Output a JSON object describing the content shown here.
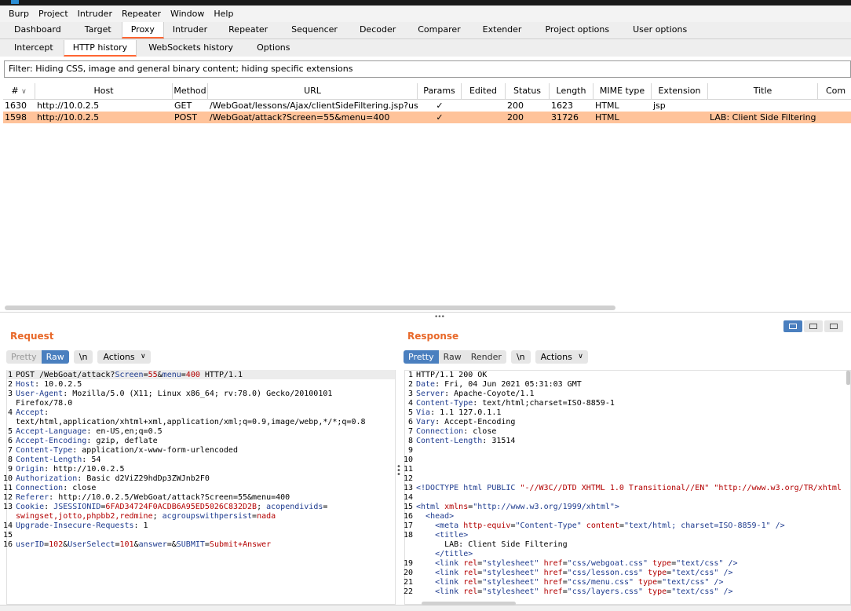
{
  "menubar": [
    "Burp",
    "Project",
    "Intruder",
    "Repeater",
    "Window",
    "Help"
  ],
  "main_tabs": [
    {
      "label": "Dashboard",
      "active": false
    },
    {
      "label": "Target",
      "active": false
    },
    {
      "label": "Proxy",
      "active": true
    },
    {
      "label": "Intruder",
      "active": false
    },
    {
      "label": "Repeater",
      "active": false
    },
    {
      "label": "Sequencer",
      "active": false
    },
    {
      "label": "Decoder",
      "active": false
    },
    {
      "label": "Comparer",
      "active": false
    },
    {
      "label": "Extender",
      "active": false
    },
    {
      "label": "Project options",
      "active": false
    },
    {
      "label": "User options",
      "active": false
    }
  ],
  "sub_tabs": [
    {
      "label": "Intercept",
      "active": false
    },
    {
      "label": "HTTP history",
      "active": true
    },
    {
      "label": "WebSockets history",
      "active": false
    },
    {
      "label": "Options",
      "active": false
    }
  ],
  "filter": "Filter: Hiding CSS, image and general binary content;  hiding specific extensions",
  "table": {
    "headers": [
      "#",
      "Host",
      "Method",
      "URL",
      "Params",
      "Edited",
      "Status",
      "Length",
      "MIME type",
      "Extension",
      "Title",
      "Com"
    ],
    "sort_indicator": "∨",
    "rows": [
      {
        "num": "1630",
        "host": "http://10.0.2.5",
        "method": "GET",
        "url": "/WebGoat/lessons/Ajax/clientSideFiltering.jsp?user...",
        "params": "✓",
        "edited": "",
        "status": "200",
        "length": "1623",
        "mime": "HTML",
        "ext": "jsp",
        "title": "",
        "com": "",
        "selected": false
      },
      {
        "num": "1598",
        "host": "http://10.0.2.5",
        "method": "POST",
        "url": "/WebGoat/attack?Screen=55&menu=400",
        "params": "✓",
        "edited": "",
        "status": "200",
        "length": "31726",
        "mime": "HTML",
        "ext": "",
        "title": "LAB: Client Side Filtering",
        "com": "",
        "selected": true
      }
    ]
  },
  "request": {
    "title": "Request",
    "buttons": {
      "pretty": "Pretty",
      "raw": "Raw",
      "newline": "\\n",
      "actions": "Actions"
    }
  },
  "response": {
    "title": "Response",
    "buttons": {
      "pretty": "Pretty",
      "raw": "Raw",
      "render": "Render",
      "newline": "\\n",
      "actions": "Actions"
    }
  },
  "colors": {
    "accent": "#ff6633",
    "selected_row": "#ffc39a",
    "active_button": "#4a7fbf",
    "pane_title": "#e8692a"
  }
}
